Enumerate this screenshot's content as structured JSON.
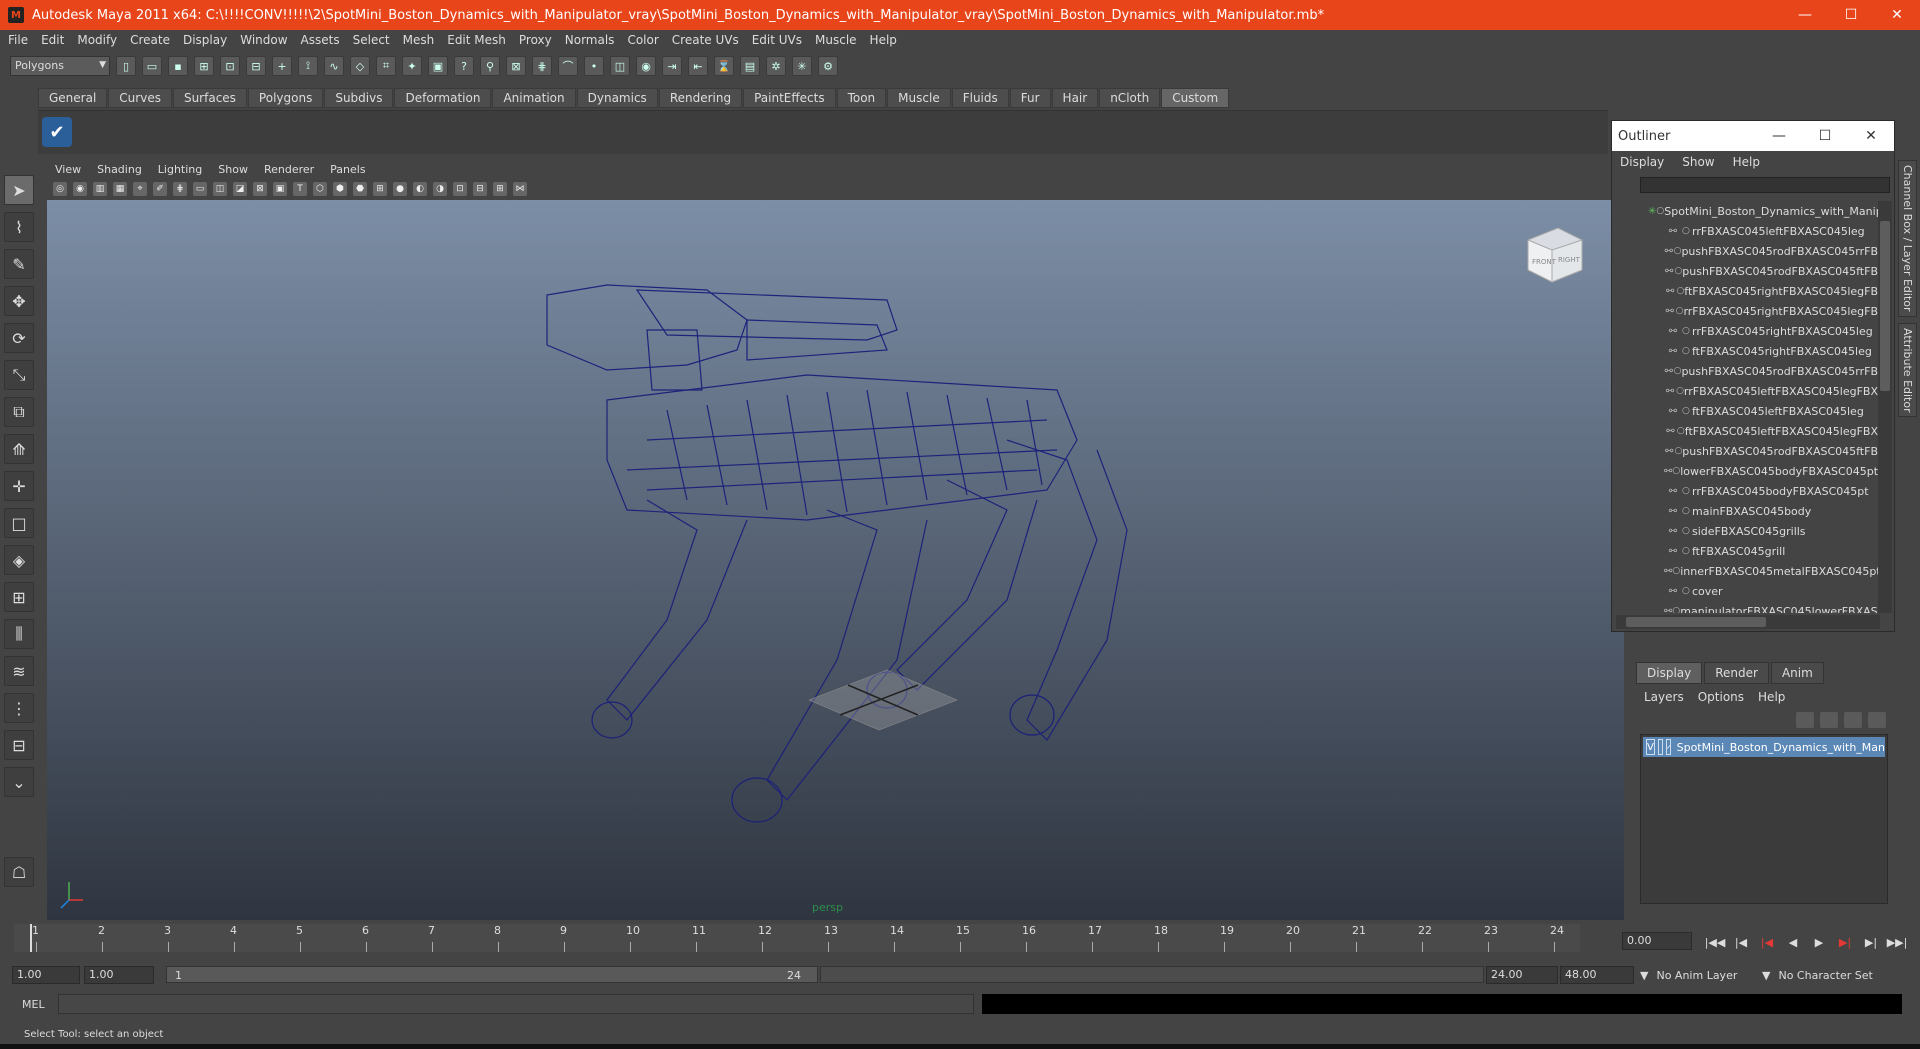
{
  "window": {
    "title": "Autodesk Maya 2011 x64: C:\\!!!!CONV!!!!!\\2\\SpotMini_Boston_Dynamics_with_Manipulator_vray\\SpotMini_Boston_Dynamics_with_Manipulator_vray\\SpotMini_Boston_Dynamics_with_Manipulator.mb*",
    "minimize": "—",
    "maximize": "☐",
    "close": "✕"
  },
  "menus": [
    "File",
    "Edit",
    "Modify",
    "Create",
    "Display",
    "Window",
    "Assets",
    "Select",
    "Mesh",
    "Edit Mesh",
    "Proxy",
    "Normals",
    "Color",
    "Create UVs",
    "Edit UVs",
    "Muscle",
    "Help"
  ],
  "mode_dropdown": "Polygons",
  "shelf_tabs": [
    "General",
    "Curves",
    "Surfaces",
    "Polygons",
    "Subdivs",
    "Deformation",
    "Animation",
    "Dynamics",
    "Rendering",
    "PaintEffects",
    "Toon",
    "Muscle",
    "Fluids",
    "Fur",
    "Hair",
    "nCloth",
    "Custom"
  ],
  "active_shelf_tab": "Custom",
  "viewport_menu": [
    "View",
    "Shading",
    "Lighting",
    "Show",
    "Renderer",
    "Panels"
  ],
  "viewport": {
    "camera_label": "persp",
    "viewcube_front": "FRONT",
    "viewcube_right": "RIGHT",
    "wire_color": "#1a1f7a"
  },
  "outliner": {
    "title": "Outliner",
    "menu": [
      "Display",
      "Show",
      "Help"
    ],
    "items": [
      "SpotMini_Boston_Dynamics_with_Manip",
      "rrFBXASC045leftFBXASC045leg",
      "pushFBXASC045rodFBXASC045rrFB",
      "pushFBXASC045rodFBXASC045ftFB",
      "ftFBXASC045rightFBXASC045legFB",
      "rrFBXASC045rightFBXASC045legFB",
      "rrFBXASC045rightFBXASC045leg",
      "ftFBXASC045rightFBXASC045leg",
      "pushFBXASC045rodFBXASC045rrFB",
      "rrFBXASC045leftFBXASC045legFBX",
      "ftFBXASC045leftFBXASC045leg",
      "ftFBXASC045leftFBXASC045legFBX",
      "pushFBXASC045rodFBXASC045ftFB",
      "lowerFBXASC045bodyFBXASC045pt",
      "rrFBXASC045bodyFBXASC045pt",
      "mainFBXASC045body",
      "sideFBXASC045grills",
      "ftFBXASC045grill",
      "innerFBXASC045metalFBXASC045pt",
      "cover",
      "manipulatorFBXASC045lowerFBXASC"
    ]
  },
  "side_tabs": [
    "Channel Box / Layer Editor",
    "Attribute Editor"
  ],
  "layer_panel": {
    "tabs": [
      "Display",
      "Render",
      "Anim"
    ],
    "active_tab": "Display",
    "menu": [
      "Layers",
      "Options",
      "Help"
    ],
    "layer_visibility": "V",
    "layer_name": "SpotMini_Boston_Dynamics_with_Man"
  },
  "timeline": {
    "ticks": [
      "1",
      "2",
      "3",
      "4",
      "5",
      "6",
      "7",
      "8",
      "9",
      "10",
      "11",
      "12",
      "13",
      "14",
      "15",
      "16",
      "17",
      "18",
      "19",
      "20",
      "21",
      "22",
      "23",
      "24"
    ],
    "current_time": "0.00"
  },
  "range": {
    "start_time": "1.00",
    "playback_start": "1.00",
    "slider_start": "1",
    "slider_end": "24",
    "playback_end": "24.00",
    "end_time": "48.00",
    "anim_layer": "No Anim Layer",
    "character_set": "No Character Set"
  },
  "command_line": {
    "label": "MEL"
  },
  "help_line": "Select Tool: select an object"
}
